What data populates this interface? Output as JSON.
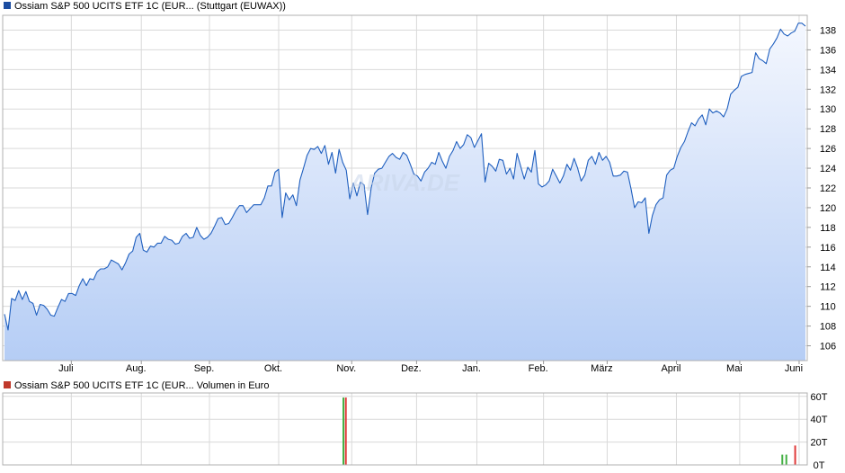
{
  "colors": {
    "price_line": "#1f5fbf",
    "area_top": "#f4f7fe",
    "area_bottom": "#b5cdf5",
    "grid": "#d9d9d9",
    "legend_price": "#1c4da1",
    "legend_volume": "#c0392b",
    "vol_up": "#44b044",
    "vol_down": "#e03a3a"
  },
  "chart_data": [
    {
      "type": "area",
      "title": "Ossiam S&P 500 UCITS ETF 1C (EUR... (Stuttgart (EUWAX))",
      "legend": "Ossiam S&P 500 UCITS ETF 1C (EUR... (Stuttgart (EUWAX))",
      "ylim": [
        104.5,
        139.5
      ],
      "y_ticks": [
        "106",
        "108",
        "110",
        "112",
        "114",
        "116",
        "118",
        "120",
        "122",
        "124",
        "126",
        "128",
        "130",
        "132",
        "134",
        "136",
        "138"
      ],
      "x_ticks": [
        "Juli",
        "Aug.",
        "Sep.",
        "Okt.",
        "Nov.",
        "Dez.",
        "Jan.",
        "Feb.",
        "März",
        "April",
        "Mai",
        "Juni"
      ],
      "grid": true,
      "series": [
        {
          "values": [
            109.2,
            107.6,
            110.8,
            110.6,
            111.6,
            110.7,
            111.5,
            110.5,
            110.3,
            109.1,
            110.2,
            110.1,
            109.7,
            109.1,
            109.0,
            109.9,
            110.7,
            110.5,
            111.3,
            111.3,
            111.1,
            112.1,
            112.8,
            112.1,
            112.8,
            112.7,
            113.5,
            113.8,
            113.8,
            114.0,
            114.7,
            114.5,
            114.3,
            113.7,
            114.4,
            115.3,
            115.6,
            117.0,
            117.4,
            115.7,
            115.5,
            116.1,
            116.0,
            116.4,
            116.4,
            117.1,
            116.8,
            116.7,
            116.3,
            116.4,
            117.1,
            117.4,
            116.9,
            117.0,
            118.0,
            117.2,
            116.8,
            117.0,
            117.4,
            118.1,
            118.9,
            119.0,
            118.3,
            118.4,
            119.0,
            119.7,
            120.2,
            120.2,
            119.5,
            119.9,
            120.3,
            120.3,
            120.3,
            121.0,
            122.2,
            122.2,
            123.6,
            123.9,
            119.0,
            121.5,
            120.8,
            121.3,
            120.2,
            122.8,
            124.0,
            125.3,
            126.0,
            125.9,
            126.2,
            125.5,
            126.3,
            124.4,
            125.6,
            123.5,
            125.9,
            124.6,
            123.8,
            120.9,
            122.5,
            121.2,
            122.6,
            122.3,
            119.3,
            122.0,
            123.5,
            123.9,
            124.0,
            124.6,
            125.2,
            125.5,
            125.1,
            124.9,
            125.6,
            125.3,
            124.4,
            123.4,
            123.2,
            122.7,
            123.6,
            124.0,
            124.6,
            124.4,
            125.6,
            124.7,
            124.0,
            125.2,
            125.8,
            126.7,
            126.0,
            126.4,
            127.4,
            127.1,
            126.1,
            126.8,
            127.5,
            122.6,
            124.5,
            124.2,
            123.7,
            124.9,
            124.8,
            123.4,
            124.0,
            122.9,
            125.5,
            124.2,
            122.9,
            124.1,
            123.6,
            125.8,
            122.4,
            122.1,
            122.3,
            122.7,
            123.9,
            123.2,
            122.5,
            123.2,
            124.4,
            123.8,
            125.0,
            124.0,
            122.7,
            123.3,
            124.8,
            125.2,
            124.4,
            125.6,
            124.8,
            125.2,
            124.6,
            123.2,
            123.2,
            123.3,
            123.7,
            123.6,
            121.9,
            120.0,
            120.6,
            120.5,
            121.0,
            117.4,
            119.2,
            120.3,
            120.8,
            121.0,
            123.3,
            123.8,
            124.0,
            125.2,
            126.1,
            126.7,
            127.7,
            128.6,
            128.3,
            129.0,
            129.4,
            128.4,
            130.0,
            129.6,
            129.8,
            129.6,
            129.2,
            130.0,
            131.5,
            131.9,
            132.2,
            133.3,
            133.5,
            133.6,
            133.7,
            135.7,
            135.1,
            134.9,
            134.6,
            136.1,
            136.6,
            137.2,
            138.1,
            137.6,
            137.4,
            137.7,
            137.9,
            138.7,
            138.7,
            138.4
          ]
        }
      ]
    },
    {
      "type": "bar",
      "title": "Ossiam S&P 500 UCITS ETF 1C (EUR... Volumen in Euro",
      "legend": "Ossiam S&P 500 UCITS ETF 1C (EUR... Volumen in Euro",
      "ylim": [
        0,
        63
      ],
      "y_ticks": [
        "60T",
        "40T",
        "20T",
        "0T"
      ],
      "grid": true,
      "series": [
        {
          "values": [
            {
              "t": 0.4235,
              "v": 59,
              "dir": "up"
            },
            {
              "t": 0.4265,
              "v": 59,
              "dir": "down"
            },
            {
              "t": 0.969,
              "v": 9,
              "dir": "up"
            },
            {
              "t": 0.974,
              "v": 9,
              "dir": "up"
            },
            {
              "t": 0.985,
              "v": 17,
              "dir": "down"
            }
          ]
        }
      ]
    }
  ],
  "watermark": "ARIVA.DE"
}
